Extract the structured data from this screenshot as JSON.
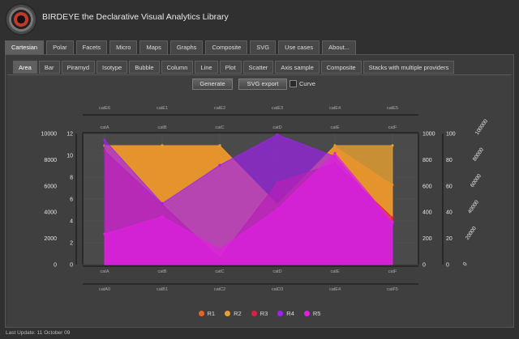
{
  "app": {
    "title": "BIRDEYE the Declarative Visual Analytics Library"
  },
  "main_tabs": [
    "Cartesian",
    "Polar",
    "Facets",
    "Micro",
    "Maps",
    "Graphs",
    "Composite",
    "SVG",
    "Use cases",
    "About..."
  ],
  "main_tab_selected": "Cartesian",
  "sub_tabs": [
    "Area",
    "Bar",
    "Piramyd",
    "Isotype",
    "Bubble",
    "Column",
    "Line",
    "Plot",
    "Scatter",
    "Axis sample",
    "Composite",
    "Stacks with multiple providers"
  ],
  "sub_tab_selected": "Area",
  "toolbar": {
    "generate_label": "Generate",
    "svg_export_label": "SVG export",
    "curve_label": "Curve",
    "curve_checked": false
  },
  "footer": {
    "last_update": "Last Update: 11 October 09"
  },
  "colors": {
    "R1": "#e8641e",
    "R2": "#e8a030",
    "R3": "#e02040",
    "R4": "#a020f0",
    "R5": "#e020e0"
  },
  "chart_data": {
    "type": "area",
    "categories": [
      "cat1",
      "cat2",
      "cat3",
      "cat4",
      "cat5",
      "cat6"
    ],
    "axes": {
      "top_outer_ticks": [
        "catE6",
        "catE1",
        "catE2",
        "catE3",
        "catE4",
        "catE5"
      ],
      "top_inner_ticks": [
        "catA",
        "catB",
        "catC",
        "catD",
        "catE",
        "catF"
      ],
      "bottom_inner_ticks": [
        "catA",
        "catB",
        "catC",
        "catD",
        "catE",
        "catF"
      ],
      "bottom_outer_ticks": [
        "catA0",
        "catB1",
        "catC2",
        "catD3",
        "catE4",
        "catF5"
      ],
      "left_outer": {
        "range": [
          0,
          10000
        ],
        "ticks": [
          "0",
          "2000",
          "4000",
          "6000",
          "8000",
          "10000"
        ]
      },
      "left_inner": {
        "range": [
          0,
          12
        ],
        "ticks": [
          "0",
          "2",
          "4",
          "6",
          "8",
          "10",
          "12"
        ]
      },
      "right_inner": {
        "range": [
          0,
          1000
        ],
        "ticks": [
          "0",
          "200",
          "400",
          "600",
          "800",
          "1000"
        ]
      },
      "right_mid": {
        "range": [
          0,
          100
        ],
        "ticks": [
          "0",
          "20",
          "40",
          "60",
          "80",
          "100"
        ]
      },
      "right_outer": {
        "range": [
          0,
          100000
        ],
        "ticks": [
          "0",
          "20000",
          "40000",
          "60000",
          "80000",
          "100000"
        ]
      }
    },
    "series": [
      {
        "name": "R1",
        "values": [
          10.9,
          10.9,
          10.9,
          5.5,
          10.8,
          7.3
        ]
      },
      {
        "name": "R2",
        "values": [
          10.9,
          10.9,
          10.9,
          5.5,
          10.9,
          10.9
        ]
      },
      {
        "name": "R3",
        "values": [
          10.4,
          5.5,
          0.6,
          7.5,
          9.3,
          4.3
        ]
      },
      {
        "name": "R4",
        "values": [
          11.4,
          5.6,
          9.1,
          11.9,
          9.9,
          3.7
        ]
      },
      {
        "name": "R5",
        "values": [
          2.8,
          4.4,
          1.4,
          5.1,
          10.2,
          3.9
        ]
      }
    ],
    "grid": true,
    "legend": "bottom-center"
  }
}
